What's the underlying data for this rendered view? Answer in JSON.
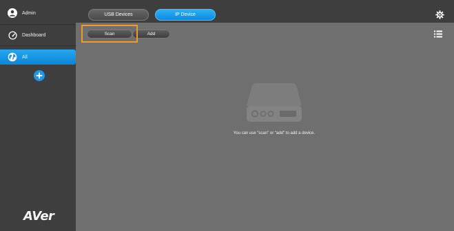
{
  "sidebar": {
    "user": {
      "label": "Admin",
      "icon": "user-icon"
    },
    "dashboard": {
      "label": "Dashboard",
      "icon": "dashboard-gauge-icon"
    },
    "group_all": {
      "label": "All",
      "icon": "globe-icon",
      "selected": true
    },
    "add_group": {
      "icon": "plus-circle-icon"
    },
    "logo": "AVer"
  },
  "topbar": {
    "tabs": [
      {
        "label": "USB Devices",
        "active": false
      },
      {
        "label": "IP Device",
        "active": true
      }
    ],
    "settings_icon": "gear-icon"
  },
  "toolbar": {
    "scan_label": "Scan",
    "add_label": "Add",
    "view_icon": "list-view-icon",
    "highlighted_button": "Scan"
  },
  "main": {
    "empty_illustration": "device-icon",
    "empty_message": "You can use \"scan\" or \"add\" to add a device."
  },
  "colors": {
    "accent": "#1e98ea",
    "sidebar_bg": "#3e3e3e",
    "content_bg": "#6f6f6f",
    "highlight": "#f39c25"
  }
}
